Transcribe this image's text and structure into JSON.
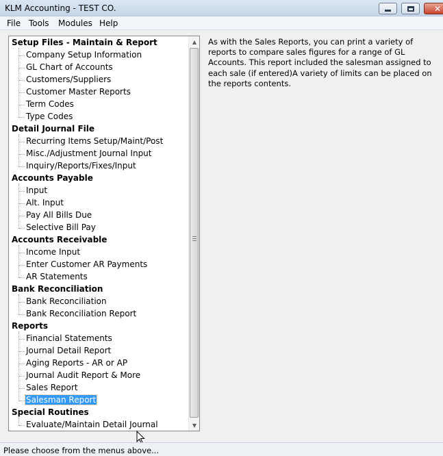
{
  "window": {
    "title": "KLM Accounting - TEST CO.",
    "close_symbol": "✕"
  },
  "menu": [
    "File",
    "Tools",
    "Modules",
    "Help"
  ],
  "tree": {
    "sections": [
      {
        "header": "Setup Files - Maintain & Report",
        "items": [
          "Company Setup Information",
          "GL Chart of Accounts",
          "Customers/Suppliers",
          "Customer Master Reports",
          "Term Codes",
          "Type Codes"
        ]
      },
      {
        "header": "Detail Journal File",
        "items": [
          "Recurring Items Setup/Maint/Post",
          "Misc./Adjustment Journal Input",
          "Inquiry/Reports/Fixes/Input"
        ]
      },
      {
        "header": "Accounts Payable",
        "items": [
          "Input",
          "Alt. Input",
          "Pay All Bills Due",
          "Selective Bill Pay"
        ]
      },
      {
        "header": "Accounts Receivable",
        "items": [
          "Income Input",
          "Enter Customer AR Payments",
          "AR Statements"
        ]
      },
      {
        "header": "Bank Reconciliation",
        "items": [
          "Bank Reconciliation",
          "Bank Reconciliation Report"
        ]
      },
      {
        "header": "Reports",
        "items": [
          "Financial Statements",
          "Journal Detail Report",
          "Aging Reports - AR or AP",
          "Journal Audit Report & More",
          "Sales Report",
          "Salesman Report"
        ]
      },
      {
        "header": "Special Routines",
        "items": [
          "Evaluate/Maintain Detail Journal"
        ]
      }
    ],
    "selected": "Salesman Report"
  },
  "description": "As with the Sales Reports, you can print a variety of reports to compare sales figures for a range of GL Accounts. This report included the salesman assigned to each sale (if entered)A variety of limits can be placed on the reports contents.",
  "status": "Please choose from the menus above...",
  "colors": {
    "selection": "#3399ff",
    "titlebar": "#c6d5e7"
  },
  "icons": {
    "cursor": "mouse-pointer-icon",
    "scroll_up": "arrow-up-icon",
    "scroll_down": "arrow-down-icon"
  }
}
